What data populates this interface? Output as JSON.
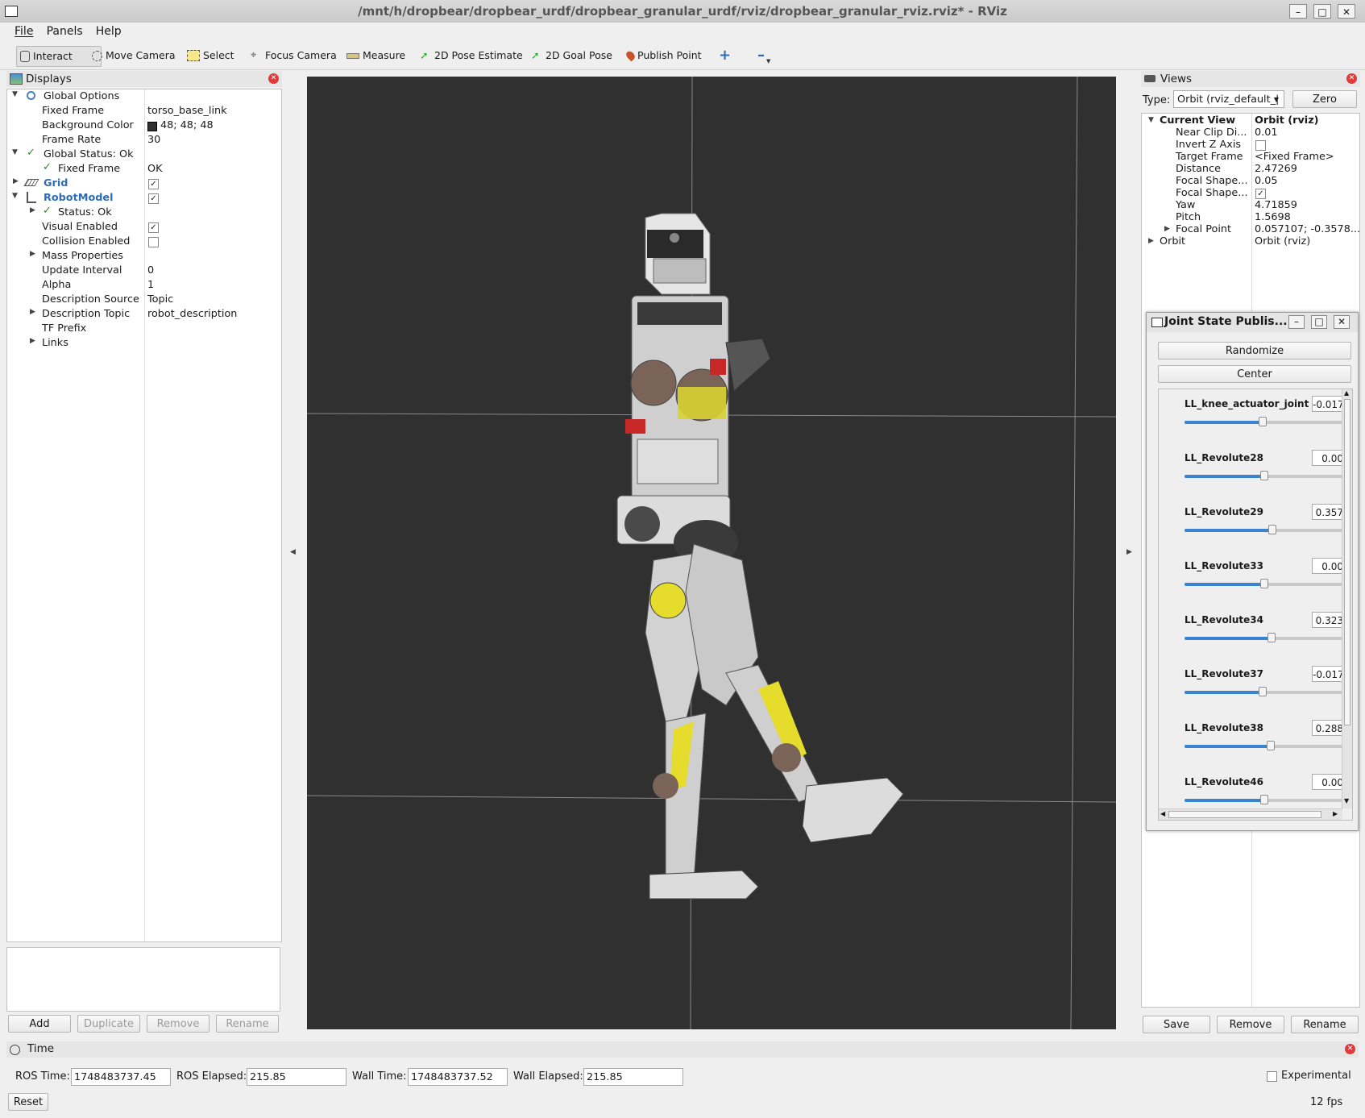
{
  "window": {
    "title": "/mnt/h/dropbear/dropbear_urdf/dropbear_granular_urdf/rviz/dropbear_granular_rviz.rviz* - RViz"
  },
  "menu": [
    "File",
    "Panels",
    "Help"
  ],
  "toolbar": {
    "tools": [
      {
        "label": "Interact",
        "icon": "hand-icon"
      },
      {
        "label": "Move Camera",
        "icon": "move-camera-icon"
      },
      {
        "label": "Select",
        "icon": "select-icon"
      },
      {
        "label": "Focus Camera",
        "icon": "focus-icon"
      },
      {
        "label": "Measure",
        "icon": "ruler-icon"
      },
      {
        "label": "2D Pose Estimate",
        "icon": "green-arrow-icon"
      },
      {
        "label": "2D Goal Pose",
        "icon": "green-arrow-icon"
      },
      {
        "label": "Publish Point",
        "icon": "map-pin-icon"
      }
    ]
  },
  "displays": {
    "title": "Displays",
    "rows": [
      {
        "label": "Global Options",
        "value": ""
      },
      {
        "label": "Fixed Frame",
        "value": "torso_base_link"
      },
      {
        "label": "Background Color",
        "value": "48; 48; 48"
      },
      {
        "label": "Frame Rate",
        "value": "30"
      },
      {
        "label": "Global Status: Ok",
        "value": ""
      },
      {
        "label": "Fixed Frame",
        "value": "OK"
      },
      {
        "label": "Grid",
        "value": ""
      },
      {
        "label": "RobotModel",
        "value": ""
      },
      {
        "label": "Status: Ok",
        "value": ""
      },
      {
        "label": "Visual Enabled",
        "value": ""
      },
      {
        "label": "Collision Enabled",
        "value": ""
      },
      {
        "label": "Mass Properties",
        "value": ""
      },
      {
        "label": "Update Interval",
        "value": "0"
      },
      {
        "label": "Alpha",
        "value": "1"
      },
      {
        "label": "Description Source",
        "value": "Topic"
      },
      {
        "label": "Description Topic",
        "value": "robot_description"
      },
      {
        "label": "TF Prefix",
        "value": ""
      },
      {
        "label": "Links",
        "value": ""
      }
    ],
    "buttons": [
      "Add",
      "Duplicate",
      "Remove",
      "Rename"
    ],
    "bg_color_swatch": "#303030"
  },
  "views": {
    "title": "Views",
    "type_label": "Type:",
    "type_value": "Orbit (rviz_default_|",
    "zero": "Zero",
    "rows": [
      {
        "label": "Current View",
        "value": "Orbit (rviz)"
      },
      {
        "label": "Near Clip Di...",
        "value": "0.01"
      },
      {
        "label": "Invert Z Axis",
        "value": ""
      },
      {
        "label": "Target Frame",
        "value": "<Fixed Frame>"
      },
      {
        "label": "Distance",
        "value": "2.47269"
      },
      {
        "label": "Focal Shape...",
        "value": "0.05"
      },
      {
        "label": "Focal Shape...",
        "value": ""
      },
      {
        "label": "Yaw",
        "value": "4.71859"
      },
      {
        "label": "Pitch",
        "value": "1.5698"
      },
      {
        "label": "Focal Point",
        "value": "0.057107; -0.3578..."
      },
      {
        "label": "Orbit",
        "value": "Orbit (rviz)"
      }
    ],
    "buttons": [
      "Save",
      "Remove",
      "Rename"
    ]
  },
  "jsp": {
    "title": "Joint State Publis...",
    "randomize": "Randomize",
    "center": "Center",
    "joints": [
      {
        "name": "LL_knee_actuator_joint",
        "value": "-0.017",
        "level": 0.49
      },
      {
        "name": "LL_Revolute28",
        "value": "0.00",
        "level": 0.5
      },
      {
        "name": "LL_Revolute29",
        "value": "0.357",
        "level": 0.55
      },
      {
        "name": "LL_Revolute33",
        "value": "0.00",
        "level": 0.5
      },
      {
        "name": "LL_Revolute34",
        "value": "0.323",
        "level": 0.545
      },
      {
        "name": "LL_Revolute37",
        "value": "-0.017",
        "level": 0.49
      },
      {
        "name": "LL_Revolute38",
        "value": "0.288",
        "level": 0.54
      },
      {
        "name": "LL_Revolute46",
        "value": "0.00",
        "level": 0.5
      }
    ]
  },
  "time": {
    "title": "Time",
    "ros_time_label": "ROS Time:",
    "ros_time": "1748483737.45",
    "ros_elapsed_label": "ROS Elapsed:",
    "ros_elapsed": "215.85",
    "wall_time_label": "Wall Time:",
    "wall_time": "1748483737.52",
    "wall_elapsed_label": "Wall Elapsed:",
    "wall_elapsed": "215.85",
    "experimental": "Experimental",
    "reset": "Reset",
    "fps": "12 fps"
  }
}
